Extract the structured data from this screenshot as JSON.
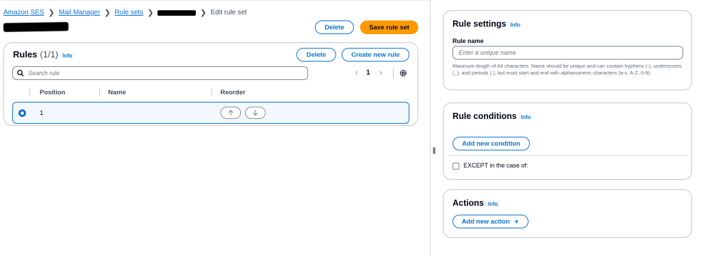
{
  "breadcrumb": {
    "items": [
      "Amazon SES",
      "Mail Manager",
      "Rule sets"
    ],
    "current": "Edit rule set"
  },
  "header": {
    "delete_label": "Delete",
    "save_label": "Save rule set"
  },
  "rules": {
    "title": "Rules",
    "count": "(1/1)",
    "info": "Info",
    "delete_label": "Delete",
    "create_label": "Create new rule",
    "search_placeholder": "Search rule",
    "page": "1",
    "columns": [
      "Position",
      "Name",
      "Reorder"
    ],
    "rows": [
      {
        "position": "1",
        "name": "",
        "selected": true
      }
    ]
  },
  "rule_settings": {
    "title": "Rule settings",
    "info": "Info",
    "name_label": "Rule name",
    "name_placeholder": "Enter a unique name",
    "hint": "Maximum length of 64 characters. Name should be unique and can contain hyphens (-), underscores (_), and periods (.), but must start and end with alphanumeric characters (a-z, A-Z, 0-9)."
  },
  "rule_conditions": {
    "title": "Rule conditions",
    "info": "Info",
    "add_label": "Add new condition",
    "except_label": "EXCEPT in the case of:"
  },
  "actions": {
    "title": "Actions",
    "info": "Info",
    "add_label": "Add new action"
  },
  "colors": {
    "accent": "#0972d3",
    "primary_button": "#ff9900",
    "text": "#000716"
  }
}
